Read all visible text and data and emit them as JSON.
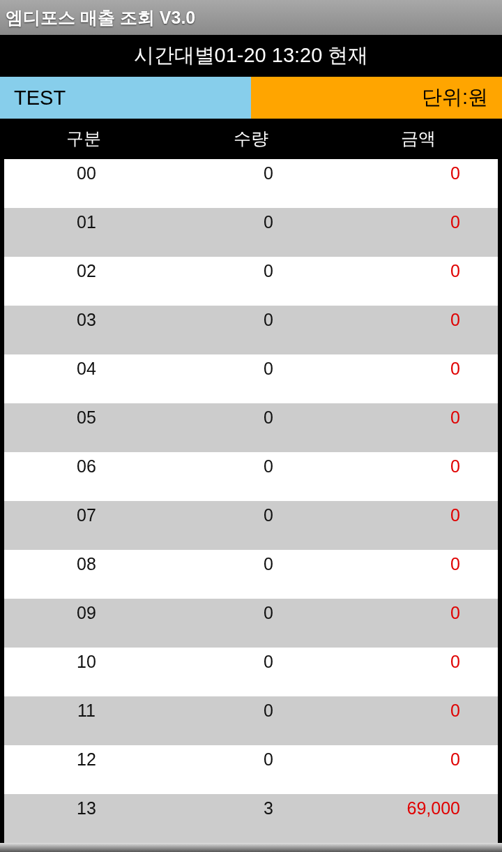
{
  "window": {
    "title": "엠디포스 매출 조회 V3.0"
  },
  "header": {
    "title": "시간대별01-20 13:20 현재"
  },
  "info": {
    "store": "TEST",
    "unit": "단위:원"
  },
  "table": {
    "columns": [
      "구분",
      "수량",
      "금액"
    ],
    "rows": [
      {
        "hour": "00",
        "qty": "0",
        "amount": "0"
      },
      {
        "hour": "01",
        "qty": "0",
        "amount": "0"
      },
      {
        "hour": "02",
        "qty": "0",
        "amount": "0"
      },
      {
        "hour": "03",
        "qty": "0",
        "amount": "0"
      },
      {
        "hour": "04",
        "qty": "0",
        "amount": "0"
      },
      {
        "hour": "05",
        "qty": "0",
        "amount": "0"
      },
      {
        "hour": "06",
        "qty": "0",
        "amount": "0"
      },
      {
        "hour": "07",
        "qty": "0",
        "amount": "0"
      },
      {
        "hour": "08",
        "qty": "0",
        "amount": "0"
      },
      {
        "hour": "09",
        "qty": "0",
        "amount": "0"
      },
      {
        "hour": "10",
        "qty": "0",
        "amount": "0"
      },
      {
        "hour": "11",
        "qty": "0",
        "amount": "0"
      },
      {
        "hour": "12",
        "qty": "0",
        "amount": "0"
      },
      {
        "hour": "13",
        "qty": "3",
        "amount": "69,000"
      }
    ]
  }
}
